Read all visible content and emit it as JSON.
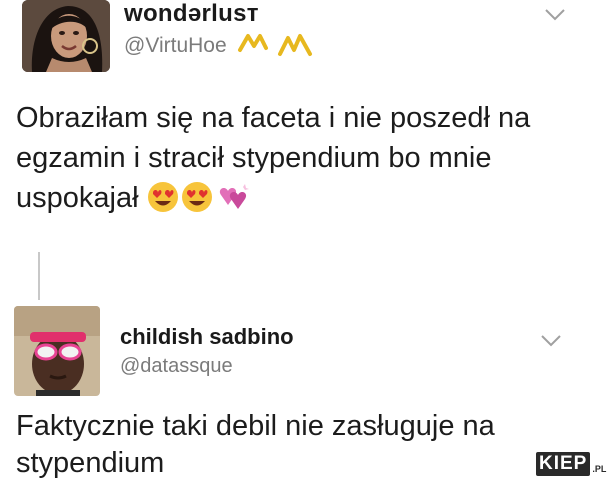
{
  "tweet1": {
    "display_name": "wondərlusт",
    "handle": "@VirtuHoe",
    "text": "Obraziłam się na faceta i nie poszedł na egzamin i stracił stypendium bo mnie uspokajał",
    "emojis": [
      "heart-eyes-emoji",
      "heart-eyes-emoji",
      "revolving-hearts-emoji"
    ]
  },
  "tweet2": {
    "display_name": "childish sadbino",
    "handle": "@datassque",
    "text": "Faktycznie taki debil nie zasługuje na stypendium"
  },
  "watermark": {
    "main": "KIEP",
    "suffix": ".PL"
  },
  "colors": {
    "text": "#1c1c1c",
    "handle": "#7b7b7b",
    "squiggle": "#e7b81f",
    "thread": "#c8c8c8"
  }
}
